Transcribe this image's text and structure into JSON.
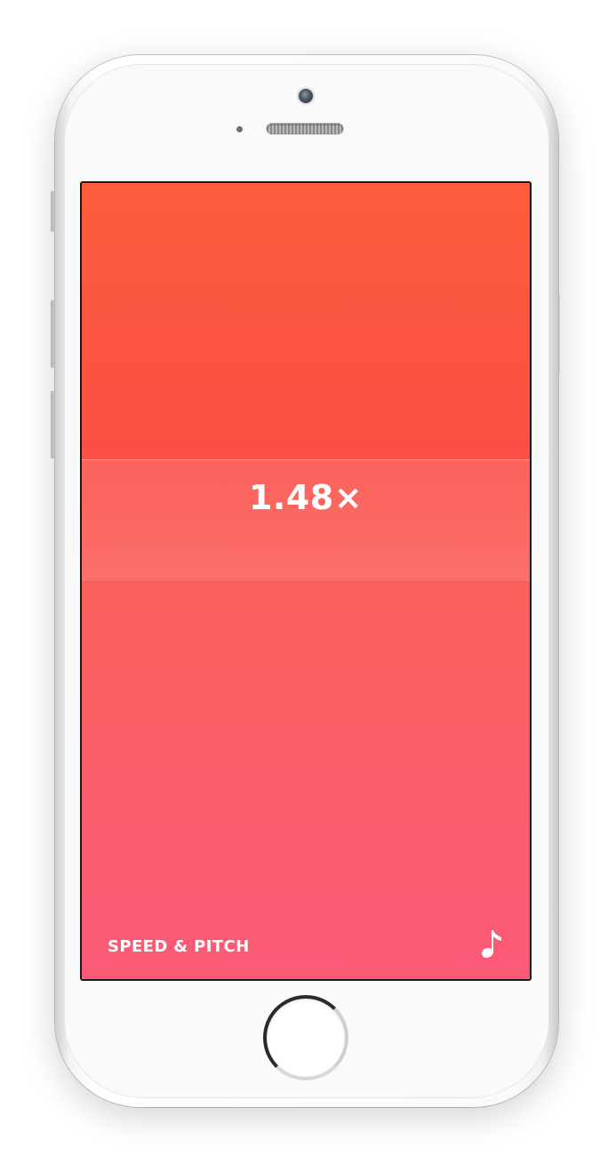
{
  "screen": {
    "speed_value": "1.48×",
    "mode_label": "SPEED & PITCH",
    "music_icon": "music-note-icon"
  },
  "colors": {
    "gradient_top": "#fb5d3b",
    "gradient_bottom": "#fb5977",
    "text": "#ffffff"
  }
}
